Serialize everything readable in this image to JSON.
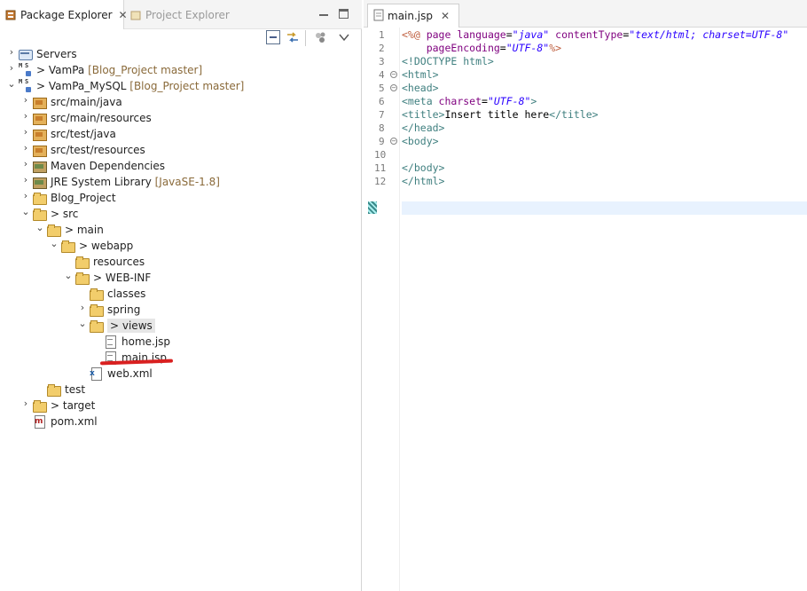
{
  "left_panel": {
    "tabs": [
      {
        "label": "Package Explorer",
        "close": "✕"
      },
      {
        "label": "Project Explorer"
      }
    ]
  },
  "tree": [
    {
      "label": "Servers",
      "deco": "",
      "depth": 0,
      "arrow": "›",
      "icon": "server"
    },
    {
      "label": "VamPa",
      "prefix": "> ",
      "deco": "[Blog_Project master]",
      "arrow": "›",
      "icon": "maven-project"
    },
    {
      "label": "VamPa_MySQL",
      "prefix": "> ",
      "deco": "[Blog_Project master]",
      "arrow": "⌄",
      "icon": "maven-project"
    },
    {
      "label": "src/main/java",
      "arrow": "›",
      "icon": "source-folder"
    },
    {
      "label": "src/main/resources",
      "arrow": "›",
      "icon": "source-folder"
    },
    {
      "label": "src/test/java",
      "arrow": "›",
      "icon": "source-folder"
    },
    {
      "label": "src/test/resources",
      "arrow": "›",
      "icon": "source-folder"
    },
    {
      "label": "Maven Dependencies",
      "arrow": "›",
      "icon": "library"
    },
    {
      "label": "JRE System Library",
      "deco": "[JavaSE-1.8]",
      "arrow": "›",
      "icon": "library"
    },
    {
      "label": "Blog_Project",
      "arrow": "›",
      "icon": "folder"
    },
    {
      "label": "src",
      "prefix": "> ",
      "arrow": "⌄",
      "icon": "folder"
    },
    {
      "label": "main",
      "prefix": "> ",
      "arrow": "⌄",
      "icon": "folder"
    },
    {
      "label": "webapp",
      "prefix": "> ",
      "arrow": "⌄",
      "icon": "folder"
    },
    {
      "label": "resources",
      "icon": "folder"
    },
    {
      "label": "WEB-INF",
      "prefix": "> ",
      "arrow": "⌄",
      "icon": "folder"
    },
    {
      "label": "classes",
      "icon": "folder"
    },
    {
      "label": "spring",
      "arrow": "›",
      "icon": "folder"
    },
    {
      "label": "views",
      "prefix": "> ",
      "arrow": "⌄",
      "icon": "folder",
      "selected": true
    },
    {
      "label": "home.jsp",
      "icon": "file"
    },
    {
      "label": "main.jsp",
      "icon": "file"
    },
    {
      "label": "web.xml",
      "icon": "xml-file"
    },
    {
      "label": "test",
      "icon": "folder"
    },
    {
      "label": "target",
      "prefix": "> ",
      "arrow": "›",
      "icon": "folder"
    },
    {
      "label": "pom.xml",
      "icon": "pom-file"
    }
  ],
  "editor": {
    "tab": {
      "label": "main.jsp",
      "close": "✕"
    },
    "line_numbers": [
      "1",
      "2",
      "3",
      "4",
      "5",
      "6",
      "7",
      "8",
      "9",
      "10",
      "11",
      "12"
    ],
    "fold_lines": [
      "4",
      "5",
      "9"
    ],
    "current_line": "12",
    "lines": [
      [
        [
          "dir",
          "<%@ "
        ],
        [
          "attr",
          "page "
        ],
        [
          "attr",
          "language"
        ],
        [
          "txt",
          "="
        ],
        [
          "val",
          "\"java\""
        ],
        [
          "txt",
          " "
        ],
        [
          "attr",
          "contentType"
        ],
        [
          "txt",
          "="
        ],
        [
          "val",
          "\"text/html; charset=UTF-8\""
        ]
      ],
      [
        [
          "txt",
          "    "
        ],
        [
          "attr",
          "pageEncoding"
        ],
        [
          "txt",
          "="
        ],
        [
          "val",
          "\"UTF-8\""
        ],
        [
          "dir",
          "%>"
        ]
      ],
      [
        [
          "tag",
          "<!DOCTYPE html>"
        ]
      ],
      [
        [
          "tag",
          "<html>"
        ]
      ],
      [
        [
          "tag",
          "<head>"
        ]
      ],
      [
        [
          "tag",
          "<meta "
        ],
        [
          "attr",
          "charset"
        ],
        [
          "txt",
          "="
        ],
        [
          "val",
          "\"UTF-8\""
        ],
        [
          "tag",
          ">"
        ]
      ],
      [
        [
          "tag",
          "<title>"
        ],
        [
          "txt",
          "Insert title here"
        ],
        [
          "tag",
          "</title>"
        ]
      ],
      [
        [
          "tag",
          "</head>"
        ]
      ],
      [
        [
          "tag",
          "<body>"
        ]
      ],
      [],
      [
        [
          "tag",
          "</body>"
        ]
      ],
      [
        [
          "tag",
          "</html>"
        ]
      ]
    ]
  }
}
